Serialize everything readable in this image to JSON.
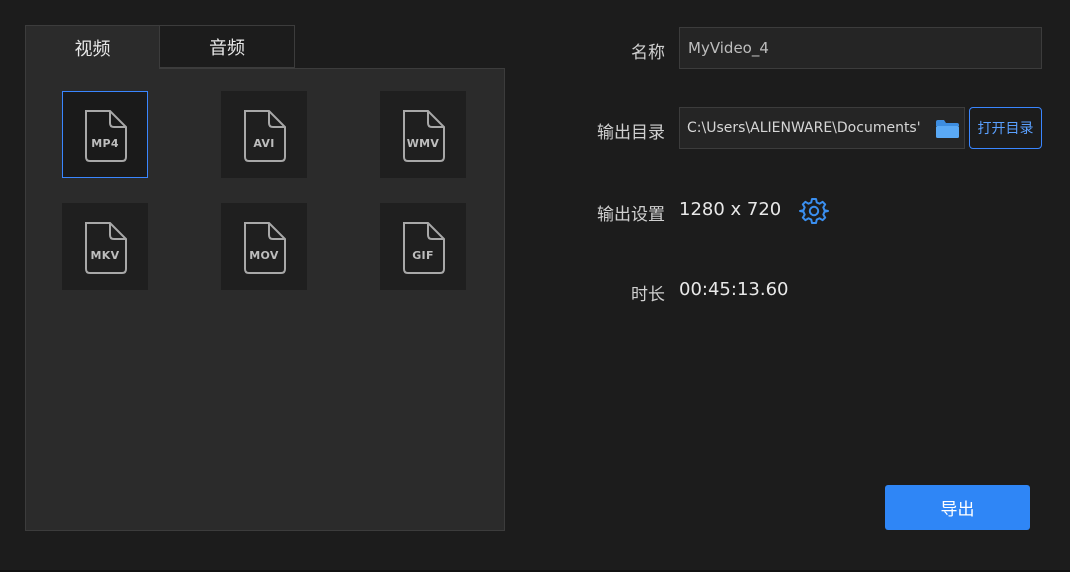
{
  "tabs": [
    {
      "label": "视频",
      "active": true
    },
    {
      "label": "音频",
      "active": false
    }
  ],
  "formats": [
    {
      "label": "MP4",
      "selected": true
    },
    {
      "label": "AVI",
      "selected": false
    },
    {
      "label": "WMV",
      "selected": false
    },
    {
      "label": "MKV",
      "selected": false
    },
    {
      "label": "MOV",
      "selected": false
    },
    {
      "label": "GIF",
      "selected": false
    }
  ],
  "name": {
    "label": "名称",
    "value": "MyVideo_4"
  },
  "output_dir": {
    "label": "输出目录",
    "value": "C:\\Users\\ALIENWARE\\Documents'",
    "open_button": "打开目录"
  },
  "output_settings": {
    "label": "输出设置",
    "value": "1280 x 720"
  },
  "duration": {
    "label": "时长",
    "value": "00:45:13.60"
  },
  "export_button": "导出",
  "colors": {
    "accent": "#2f86f6",
    "folder": "#5aa9f5"
  }
}
